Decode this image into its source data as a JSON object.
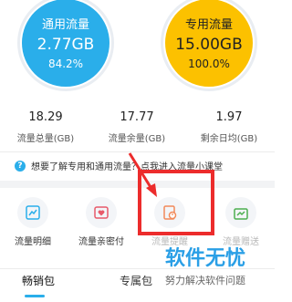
{
  "gauges": [
    {
      "title": "通用流量",
      "value": "2.77GB",
      "percent": "84.2%",
      "fill_fraction": 0.842,
      "color": "#2aaeea"
    },
    {
      "title": "专用流量",
      "value": "15.00GB",
      "percent": "100.0%",
      "fill_fraction": 1.0,
      "color": "#fcc100"
    }
  ],
  "stats": [
    {
      "value": "18.29",
      "label": "流量总量(GB)"
    },
    {
      "value": "17.77",
      "label": "流量余量(GB)"
    },
    {
      "value": "1.97",
      "label": "剩余日均(GB)"
    }
  ],
  "question": {
    "icon": "question-icon",
    "text": "想要了解专用和通用流量？点我进入流量小课堂"
  },
  "tiles": [
    {
      "label": "流量明细",
      "icon": "chart-icon"
    },
    {
      "label": "流量亲密付",
      "icon": "heart-card-icon"
    },
    {
      "label": "流量提醒",
      "icon": "reminder-clock-icon"
    },
    {
      "label": "流量赠送",
      "icon": "gift-icon"
    }
  ],
  "watermark": {
    "title": "软件无忧",
    "subtitle": "努力解决软件问题"
  },
  "tabs": [
    {
      "label": "畅销包",
      "active": true
    },
    {
      "label": "专属包",
      "active": false
    }
  ],
  "colors": {
    "accent": "#2aaeea",
    "highlight": "#ec2c2c",
    "yellow": "#fcc100"
  }
}
